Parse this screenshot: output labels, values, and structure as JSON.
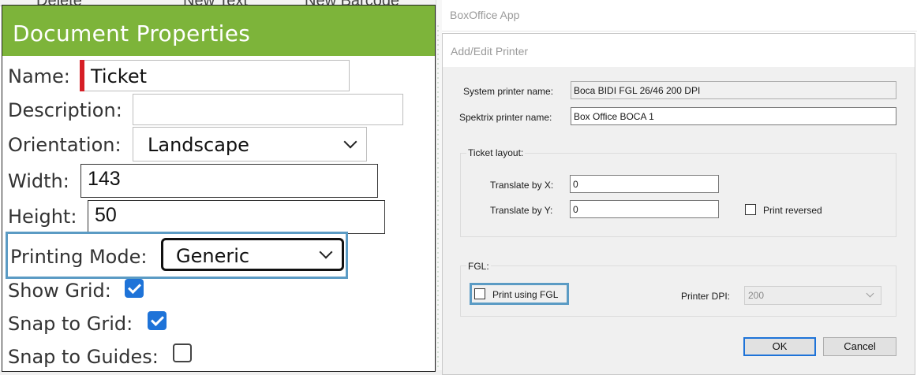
{
  "background": {
    "tabs": [
      "Delete",
      "New Text",
      "New Barcode"
    ]
  },
  "doc_props": {
    "title": "Document Properties",
    "name_label": "Name:",
    "name_value": "Ticket",
    "description_label": "Description:",
    "description_value": "",
    "orientation_label": "Orientation:",
    "orientation_value": "Landscape",
    "width_label": "Width:",
    "width_value": "143",
    "height_label": "Height:",
    "height_value": "50",
    "printing_mode_label": "Printing Mode:",
    "printing_mode_value": "Generic",
    "show_grid_label": "Show Grid:",
    "show_grid_checked": true,
    "snap_grid_label": "Snap to Grid:",
    "snap_grid_checked": true,
    "snap_guides_label": "Snap to Guides:",
    "snap_guides_checked": false,
    "colors": {
      "header": "#7db43a",
      "required": "#d61f26",
      "focus": "#5b9bc4",
      "checkbox": "#1e73d8"
    }
  },
  "app": {
    "title": "BoxOffice App"
  },
  "dialog": {
    "title": "Add/Edit Printer",
    "system_printer_label": "System printer name:",
    "system_printer_value": "Boca BIDI FGL 26/46 200 DPI",
    "spektrix_printer_label": "Spektrix printer name:",
    "spektrix_printer_value": "Box Office BOCA 1",
    "ticket_layout_title": "Ticket layout:",
    "translate_x_label": "Translate by X:",
    "translate_x_value": "0",
    "translate_y_label": "Translate by Y:",
    "translate_y_value": "0",
    "print_reversed_label": "Print reversed",
    "fgl_title": "FGL:",
    "print_fgl_label": "Print using FGL",
    "printer_dpi_label": "Printer DPI:",
    "printer_dpi_value": "200",
    "ok_label": "OK",
    "cancel_label": "Cancel"
  }
}
